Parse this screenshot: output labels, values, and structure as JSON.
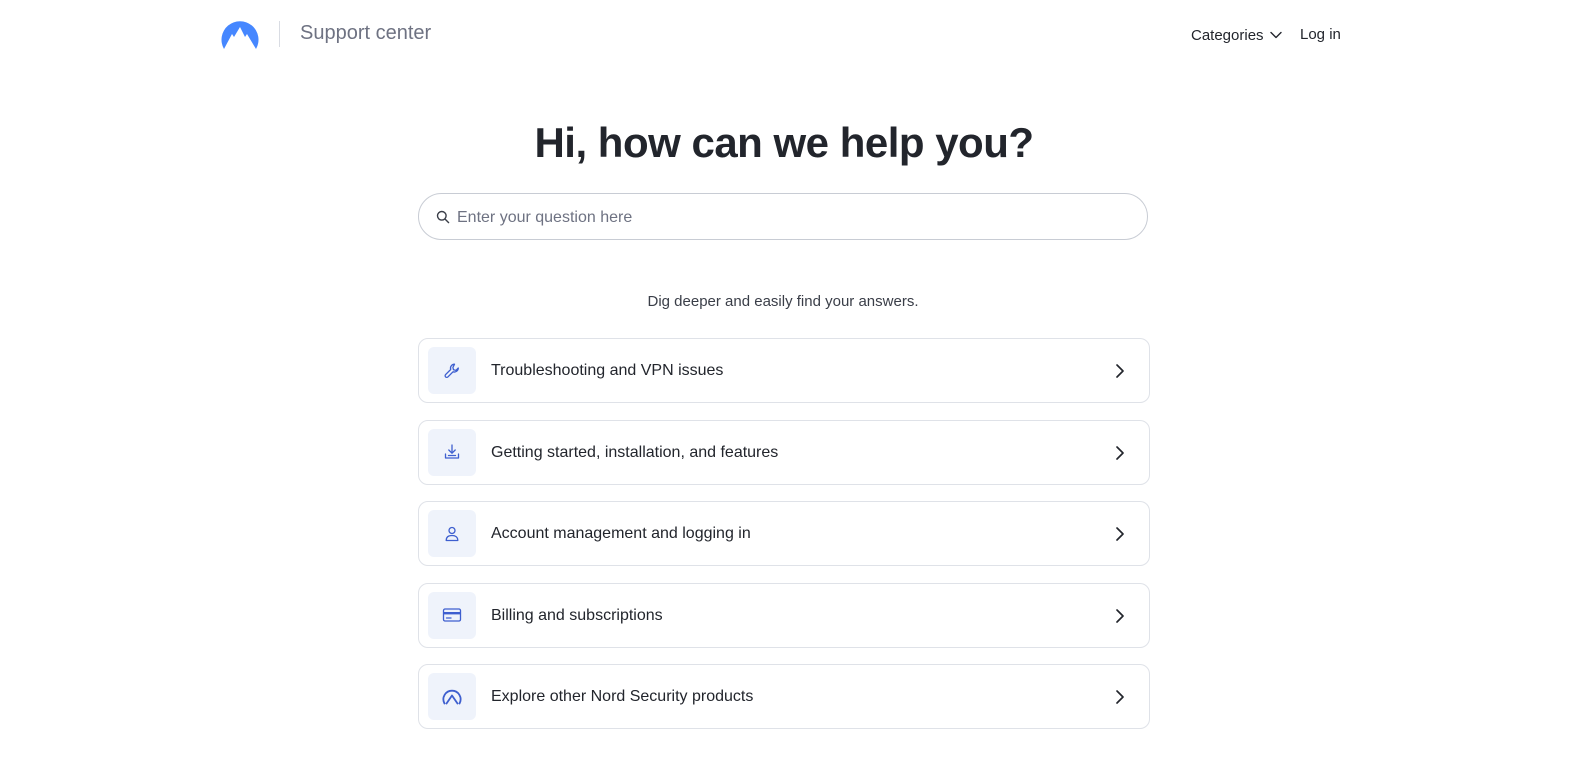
{
  "header": {
    "brand_title": "Support center",
    "nav": {
      "categories_label": "Categories",
      "login_label": "Log in"
    }
  },
  "hero": {
    "title": "Hi, how can we help you?",
    "search": {
      "placeholder": "Enter your question here",
      "value": ""
    },
    "subtitle": "Dig deeper and easily find your answers."
  },
  "categories": [
    {
      "label": "Troubleshooting and VPN issues",
      "icon": "wrench-icon"
    },
    {
      "label": "Getting started, installation, and features",
      "icon": "download-icon"
    },
    {
      "label": "Account management and logging in",
      "icon": "user-icon"
    },
    {
      "label": "Billing and subscriptions",
      "icon": "credit-card-icon"
    },
    {
      "label": "Explore other Nord Security products",
      "icon": "nord-logo-icon"
    }
  ],
  "colors": {
    "brand": "#4687ff",
    "icon_accent": "#3e5fcf",
    "icon_bg": "#eff3fb",
    "text": "#22252c",
    "muted": "#6e7282",
    "border": "#dfe2e8"
  }
}
